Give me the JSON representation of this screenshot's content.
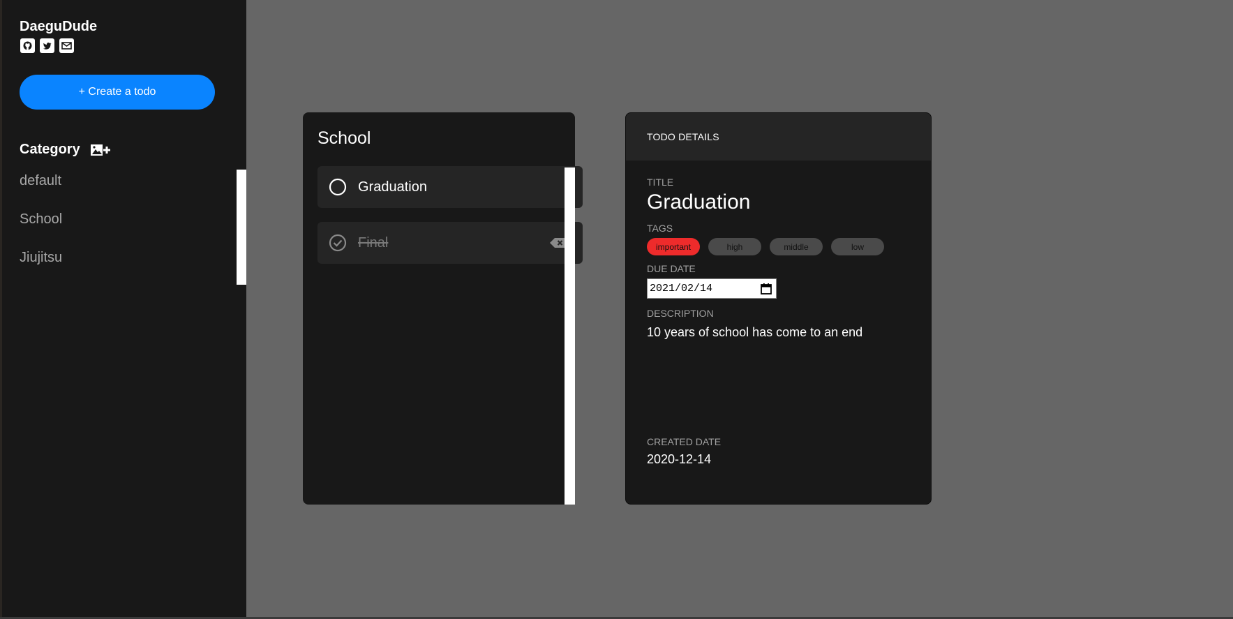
{
  "sidebar": {
    "brand": "DaeguDude",
    "social_icons": [
      "github-icon",
      "twitter-icon",
      "mail-icon"
    ],
    "create_button_label": "+ Create a todo",
    "category_title": "Category",
    "categories": [
      {
        "label": "default"
      },
      {
        "label": "School"
      },
      {
        "label": "Jiujitsu"
      }
    ]
  },
  "list": {
    "title": "School",
    "todos": [
      {
        "label": "Graduation",
        "done": false
      },
      {
        "label": "Final",
        "done": true
      }
    ]
  },
  "details": {
    "header": "TODO DETAILS",
    "title_label": "TITLE",
    "title_value": "Graduation",
    "tags_label": "TAGS",
    "tags": [
      {
        "label": "important",
        "active": true
      },
      {
        "label": "high",
        "active": false
      },
      {
        "label": "middle",
        "active": false
      },
      {
        "label": "low",
        "active": false
      }
    ],
    "due_date_label": "DUE DATE",
    "due_date_value": "2021/02/14",
    "description_label": "DESCRIPTION",
    "description_value": "10 years of school has come to an end",
    "created_date_label": "CREATED DATE",
    "created_date_value": "2020-12-14"
  },
  "colors": {
    "accent": "#0a84ff",
    "tag_active": "#ee2b2b",
    "sidebar_bg": "#181818",
    "main_bg": "#666666"
  }
}
